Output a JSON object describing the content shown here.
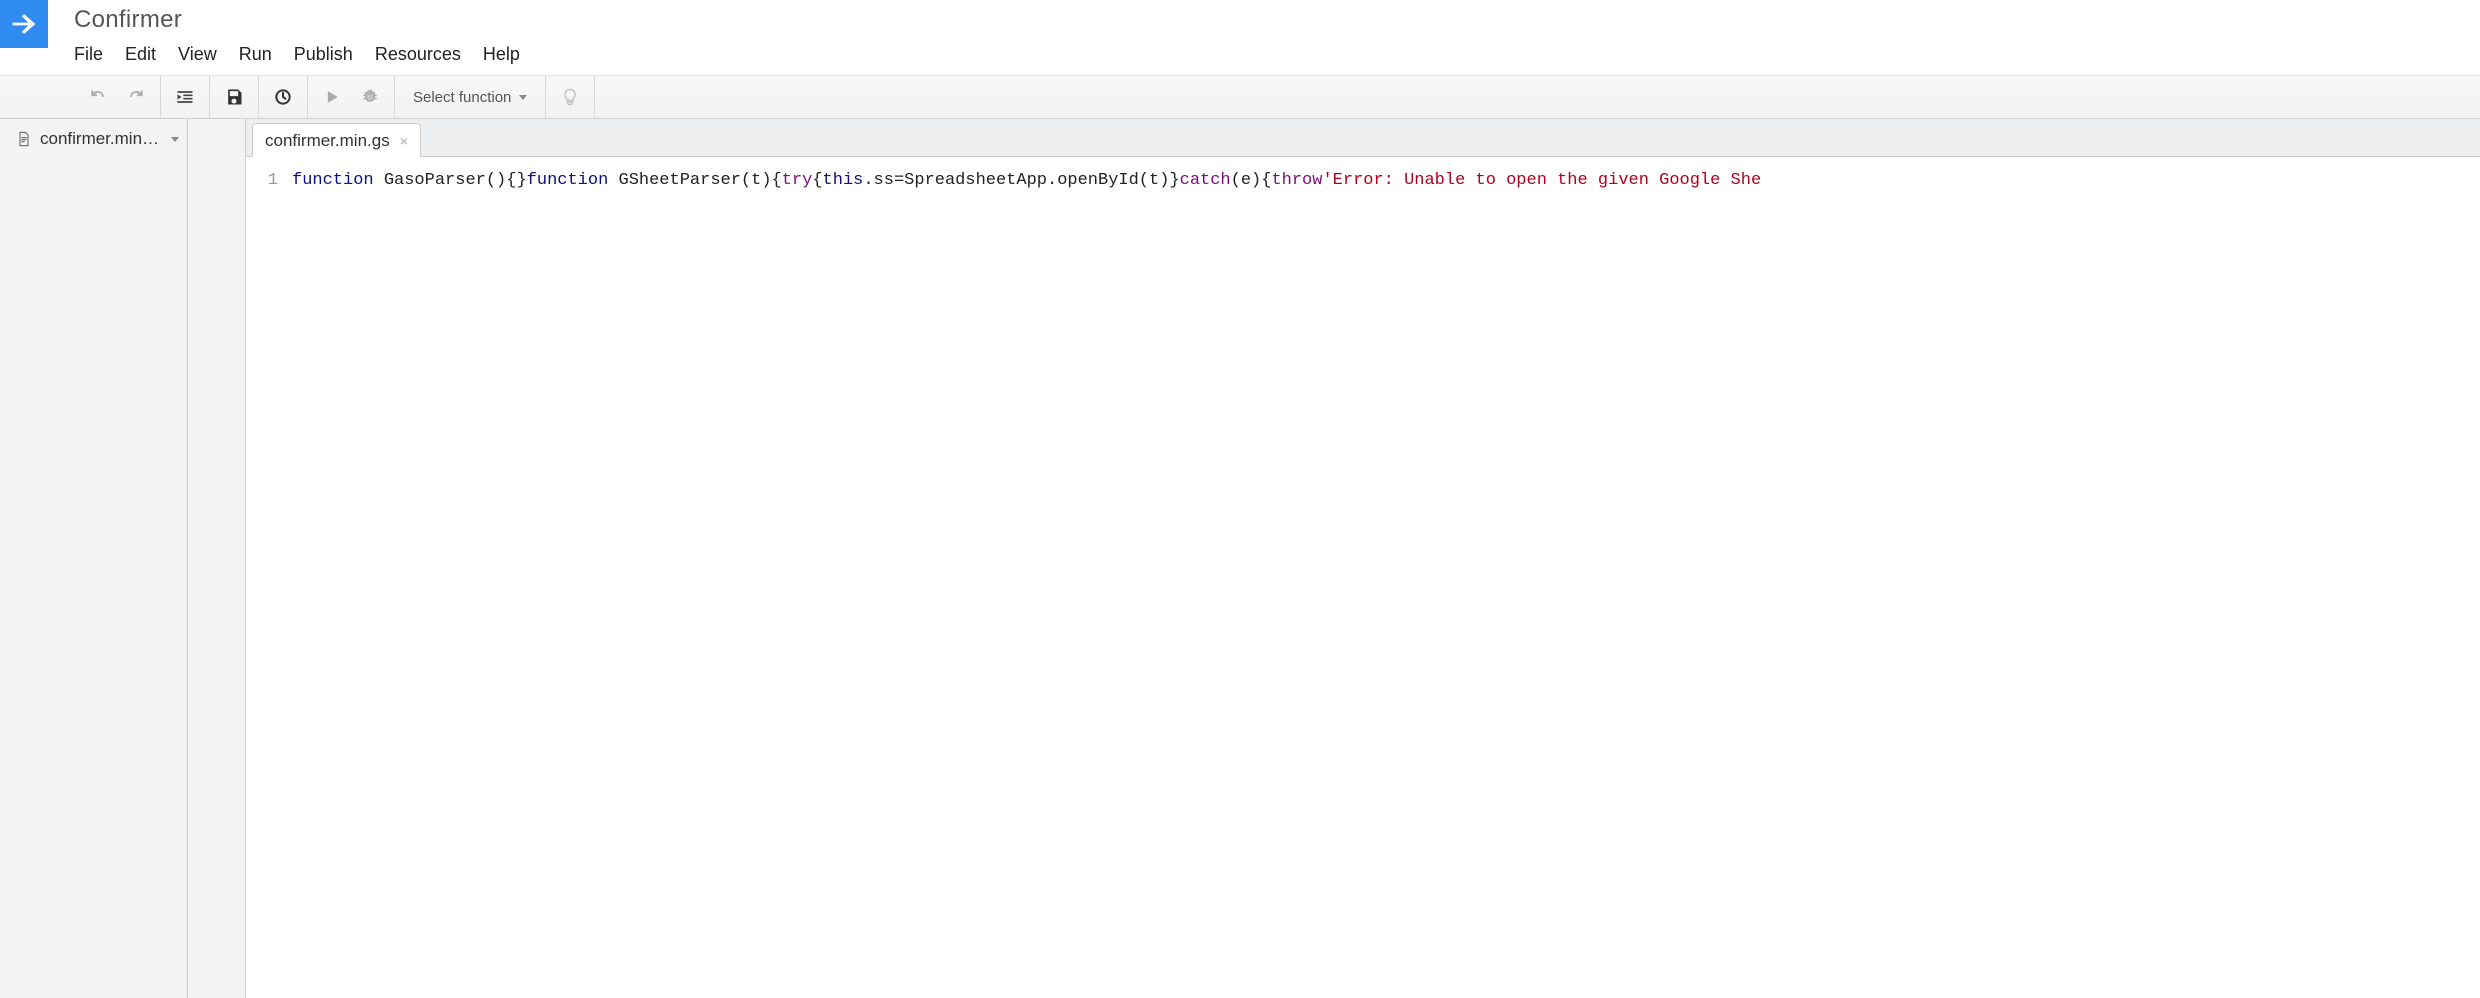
{
  "project": {
    "title": "Confirmer"
  },
  "menu": {
    "items": [
      "File",
      "Edit",
      "View",
      "Run",
      "Publish",
      "Resources",
      "Help"
    ]
  },
  "toolbar": {
    "select_function_label": "Select function"
  },
  "sidebar": {
    "files": [
      {
        "name": "confirmer.min…"
      }
    ]
  },
  "tabs": {
    "open": [
      {
        "name": "confirmer.min.gs"
      }
    ]
  },
  "editor": {
    "line_numbers": [
      "1"
    ],
    "code_tokens": [
      {
        "t": "function",
        "c": "kw"
      },
      {
        "t": " ",
        "c": "pun"
      },
      {
        "t": "GasoParser",
        "c": "id"
      },
      {
        "t": "(){}",
        "c": "pun"
      },
      {
        "t": "function",
        "c": "kw"
      },
      {
        "t": " ",
        "c": "pun"
      },
      {
        "t": "GSheetParser",
        "c": "id"
      },
      {
        "t": "(",
        "c": "pun"
      },
      {
        "t": "t",
        "c": "id"
      },
      {
        "t": "){",
        "c": "pun"
      },
      {
        "t": "try",
        "c": "kw2"
      },
      {
        "t": "{",
        "c": "pun"
      },
      {
        "t": "this",
        "c": "kw"
      },
      {
        "t": ".ss=SpreadsheetApp.openById(",
        "c": "id"
      },
      {
        "t": "t",
        "c": "id"
      },
      {
        "t": ")}",
        "c": "pun"
      },
      {
        "t": "catch",
        "c": "kw2"
      },
      {
        "t": "(",
        "c": "pun"
      },
      {
        "t": "e",
        "c": "id"
      },
      {
        "t": "){",
        "c": "pun"
      },
      {
        "t": "throw",
        "c": "kw2"
      },
      {
        "t": "'Error: Unable to open the given Google She",
        "c": "str"
      }
    ]
  }
}
